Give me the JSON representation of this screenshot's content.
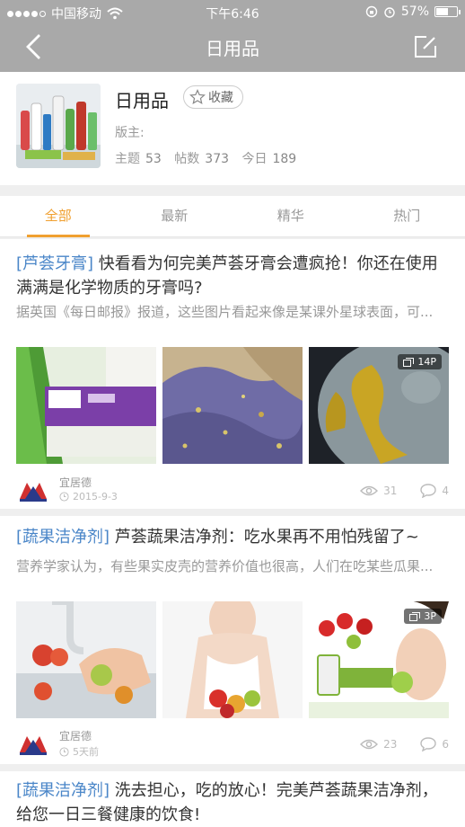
{
  "status_bar": {
    "carrier": "中国移动",
    "time": "下午6:46",
    "battery": "57%",
    "battery_level": 0.57
  },
  "nav": {
    "title": "日用品"
  },
  "forum": {
    "name": "日用品",
    "favorite_label": "收藏",
    "moderator_label": "版主:",
    "stats": [
      {
        "label": "主题",
        "value": "53"
      },
      {
        "label": "帖数",
        "value": "373"
      },
      {
        "label": "今日",
        "value": "189"
      }
    ]
  },
  "tabs": [
    {
      "label": "全部",
      "active": true
    },
    {
      "label": "最新",
      "active": false
    },
    {
      "label": "精华",
      "active": false
    },
    {
      "label": "热门",
      "active": false
    }
  ],
  "posts": [
    {
      "tag": "[芦荟牙膏]",
      "title": " 快看看为何完美芦荟牙膏会遭疯抢！你还在使用满满是化学物质的牙膏吗?",
      "excerpt": "据英国《每日邮报》报道，这些图片看起来像是某课外星球表面，可...",
      "photo_count": "14P",
      "author": "宜居德",
      "date": "2015-9-3",
      "views": "31",
      "comments": "4"
    },
    {
      "tag": "[蔬果洁净剂]",
      "title": " 芦荟蔬果洁净剂：吃水果再不用怕残留了~",
      "excerpt": "营养学家认为，有些果实皮壳的营养价值也很高，人们在吃某些瓜果...",
      "photo_count": "3P",
      "author": "宜居德",
      "date": "5天前",
      "views": "23",
      "comments": "6"
    },
    {
      "tag": "[蔬果洁净剂]",
      "title": " 洗去担心，吃的放心！完美芦荟蔬果洁净剂，给您一日三餐健康的饮食!"
    }
  ]
}
